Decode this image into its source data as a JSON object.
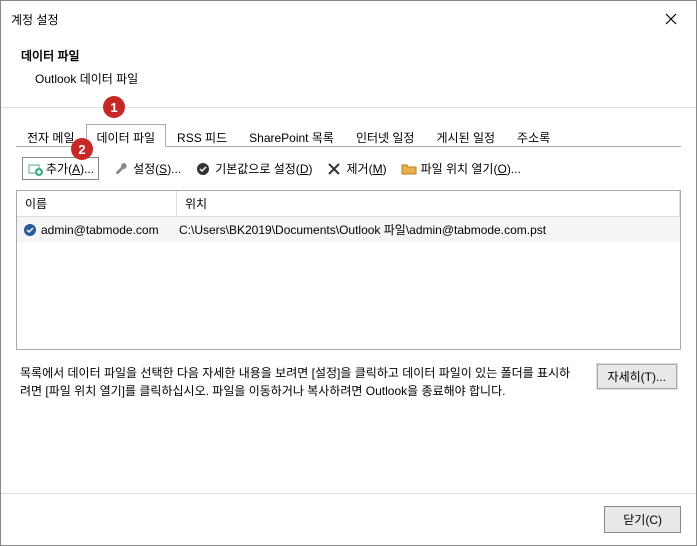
{
  "titlebar": {
    "title": "계정 설정"
  },
  "header": {
    "title": "데이터 파일",
    "subtitle": "Outlook 데이터 파일"
  },
  "tabs": [
    {
      "label": "전자 메일"
    },
    {
      "label": "데이터 파일"
    },
    {
      "label": "RSS 피드"
    },
    {
      "label": "SharePoint 목록"
    },
    {
      "label": "인터넷 일정"
    },
    {
      "label": "게시된 일정"
    },
    {
      "label": "주소록"
    }
  ],
  "toolbar": {
    "add": {
      "label": "추가(",
      "key": "A",
      "suffix": ")..."
    },
    "settings": {
      "label": "설정(",
      "key": "S",
      "suffix": ")..."
    },
    "default": {
      "label": "기본값으로 설정(",
      "key": "D",
      "suffix": ")"
    },
    "remove": {
      "label": "제거(",
      "key": "M",
      "suffix": ")"
    },
    "open": {
      "label": "파일 위치 열기(",
      "key": "O",
      "suffix": ")..."
    }
  },
  "table": {
    "headers": {
      "name": "이름",
      "location": "위치"
    },
    "rows": [
      {
        "name": "admin@tabmode.com",
        "location": "C:\\Users\\BK2019\\Documents\\Outlook 파일\\admin@tabmode.com.pst"
      }
    ]
  },
  "info": {
    "text": "목록에서 데이터 파일을 선택한 다음 자세한 내용을 보려면 [설정]을 클릭하고 데이터 파일이 있는 폴더를 표시하려면 [파일 위치 열기]를 클릭하십시오. 파일을 이동하거나 복사하려면 Outlook을 종료해야 합니다.",
    "details_btn": {
      "label": "자세히(",
      "key": "T",
      "suffix": ")..."
    }
  },
  "footer": {
    "close_btn": {
      "label": "닫기(",
      "key": "C",
      "suffix": ")"
    }
  },
  "badges": {
    "one": "1",
    "two": "2"
  }
}
